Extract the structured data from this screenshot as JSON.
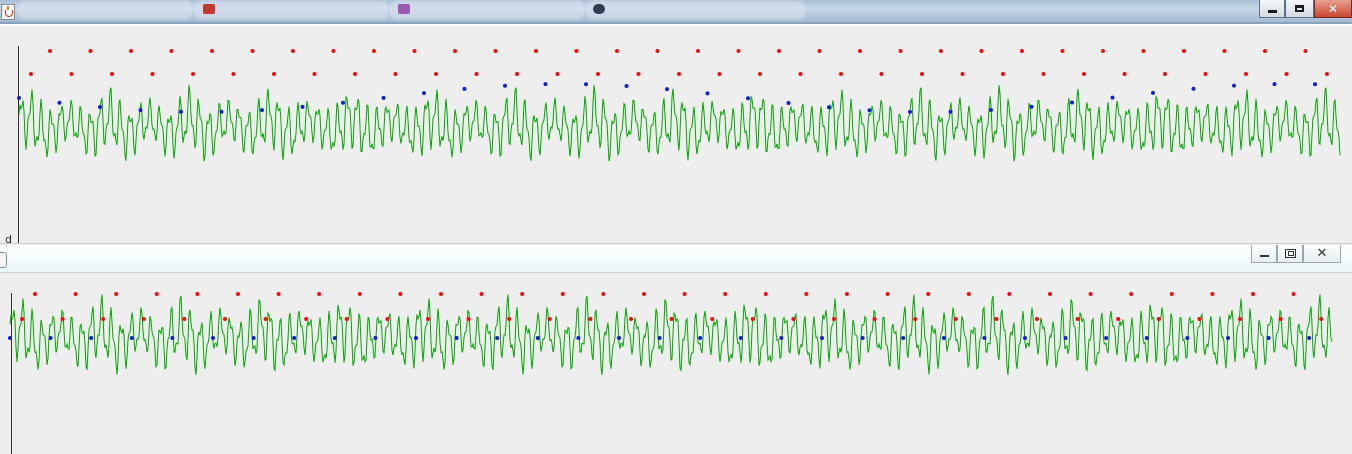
{
  "top_window": {
    "controls": {
      "minimize": "minimize",
      "maximize": "maximize",
      "close": "✕"
    },
    "plot": {
      "axis_letter": "d",
      "line_color": "#00a800",
      "peak_marker_color": "#ee1111",
      "trough_marker_color": "#1122cc"
    }
  },
  "bottom_window": {
    "controls": {
      "minimize": "minimize",
      "restore": "restore",
      "close": "✕"
    },
    "plot": {
      "line_color": "#00a800",
      "peak_marker_color": "#ee1111",
      "trough_marker_color": "#1122cc"
    }
  },
  "colors": {
    "background": "#eeeeee",
    "title_bar_top": "#b8cadf",
    "title_bar_bottom": "#eaf6f8",
    "axis": "#333333"
  }
}
